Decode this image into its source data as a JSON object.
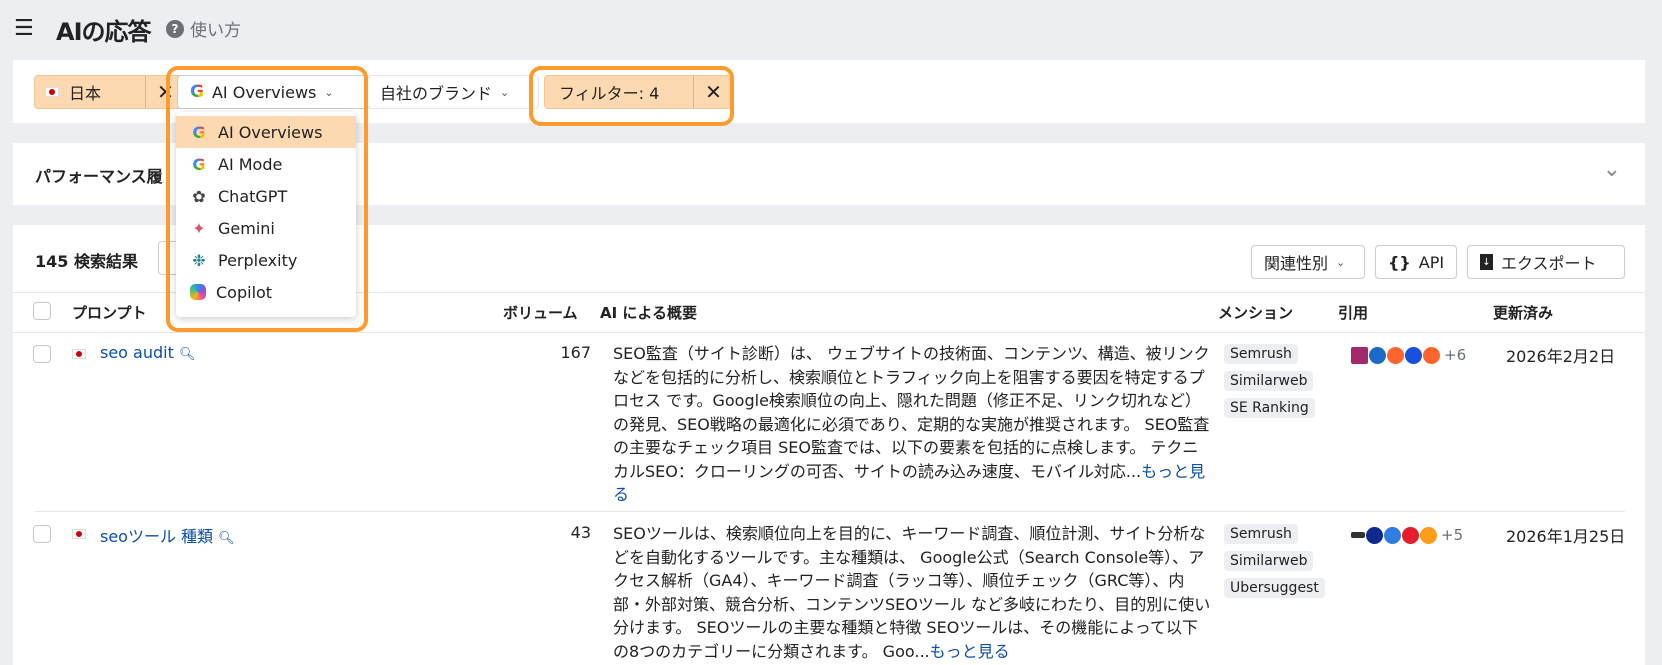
{
  "header": {
    "title": "AIの応答",
    "help": "使い方"
  },
  "filters": {
    "country": "日本",
    "source": "AI Overviews",
    "brand": "自社のブランド",
    "filter": "フィルター: 4"
  },
  "dropdown": {
    "items": [
      {
        "label": "AI Overviews",
        "icon": "google-icon",
        "selected": true
      },
      {
        "label": "AI Mode",
        "icon": "google-icon"
      },
      {
        "label": "ChatGPT",
        "icon": "chatgpt-icon"
      },
      {
        "label": "Gemini",
        "icon": "gemini-icon"
      },
      {
        "label": "Perplexity",
        "icon": "perplexity-icon"
      },
      {
        "label": "Copilot",
        "icon": "copilot-icon"
      }
    ]
  },
  "performance": {
    "title": "パフォーマンス履"
  },
  "toolbar": {
    "count": "145 検索結果",
    "sort": "関連性別",
    "api": "API",
    "export": "エクスポート"
  },
  "columns": {
    "prompt": "プロンプト",
    "volume": "ボリューム",
    "overview": "AI による概要",
    "mentions": "メンション",
    "citations": "引用",
    "updated": "更新済み"
  },
  "rows": [
    {
      "prompt": "seo audit",
      "volume": "167",
      "overview": "SEO監査（サイト診断）は、 ウェブサイトの技術面、コンテンツ、構造、被リンクなどを包括的に分析し、検索順位とトラフィック向上を阻害する要因を特定するプロセス です。Google検索順位の向上、隠れた問題（修正不足、リンク切れなど）の発見、SEO戦略の最適化に必須であり、定期的な実施が推奨されます。 SEO監査の主要なチェック項目 SEO監査では、以下の要素を包括的に点検します。 テクニカルSEO：クローリングの可否、サイトの読み込み速度、モバイル対応...",
      "more": "もっと見る",
      "mentions": [
        "Semrush",
        "Similarweb",
        "SE Ranking"
      ],
      "citations_more": "+6",
      "updated": "2026年2月2日"
    },
    {
      "prompt": "seoツール 種類",
      "volume": "43",
      "overview": "SEOツールは、検索順位向上を目的に、キーワード調査、順位計測、サイト分析などを自動化するツールです。主な種類は、 Google公式（Search Console等）、アクセス解析（GA4）、キーワード調査（ラッコ等）、順位チェック（GRC等）、内部・外部対策、競合分析、コンテンツSEOツール など多岐にわたり、目的別に使い分けます。 SEOツールの主要な種類と特徴 SEOツールは、その機能によって以下の8つのカテゴリーに分類されます。 Goo...",
      "more": "もっと見る",
      "mentions": [
        "Semrush",
        "Similarweb",
        "Ubersuggest"
      ],
      "citations_more": "+5",
      "updated": "2026年1月25日"
    }
  ],
  "colors": {
    "accent": "#ff9a2e",
    "chip": "#fcd9b0",
    "link": "#0b4fa8"
  }
}
